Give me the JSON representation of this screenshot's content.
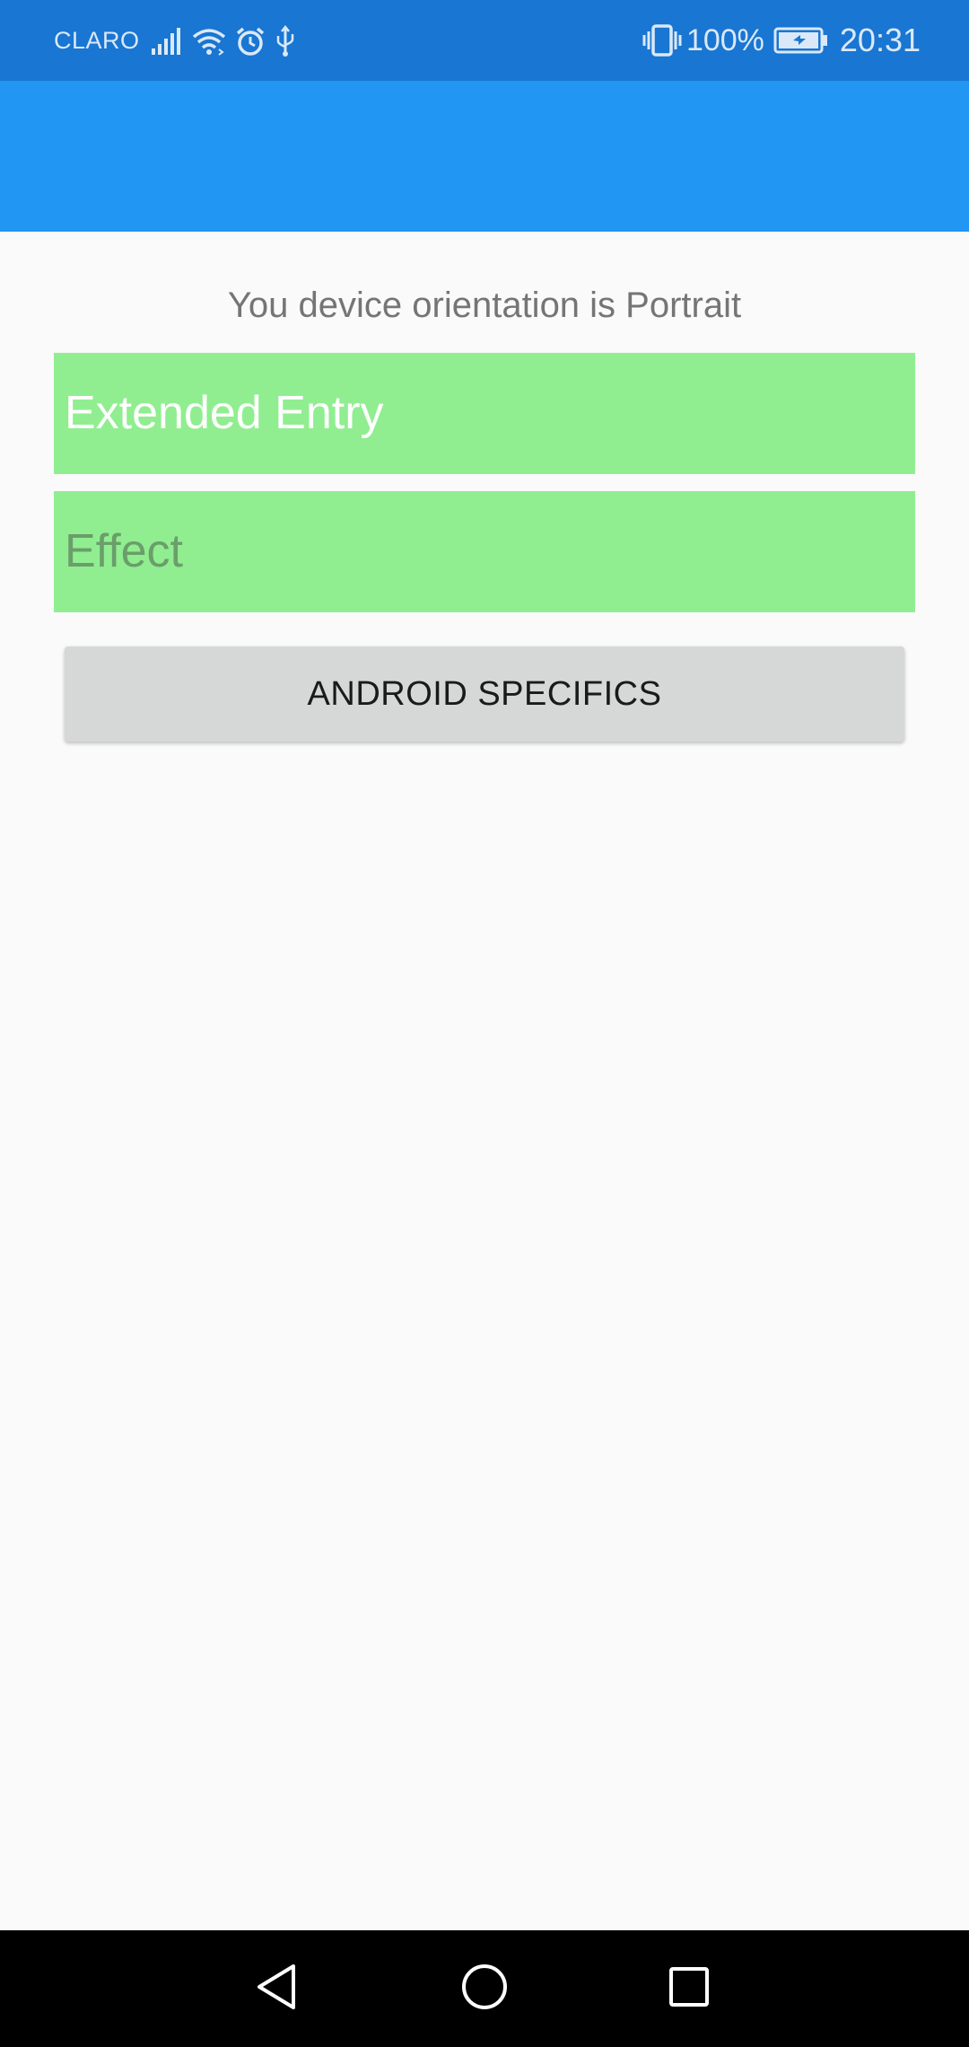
{
  "status_bar": {
    "carrier": "CLARO",
    "battery_percent": "100%",
    "time": "20:31",
    "icons": [
      "signal-icon",
      "wifi-icon",
      "alarm-icon",
      "usb-icon",
      "vibrate-icon",
      "battery-charging-icon"
    ]
  },
  "app_bar": {
    "title": ""
  },
  "main": {
    "orientation_label": "You device orientation is Portrait",
    "extended_entry_value": "Extended Entry",
    "effect_placeholder": "Effect",
    "android_specifics_button": "ANDROID SPECIFICS"
  },
  "nav_bar": {
    "icons": [
      "back-icon",
      "home-icon",
      "recents-icon"
    ]
  },
  "colors": {
    "status_bar": "#1976d2",
    "app_bar": "#2196f3",
    "entry_background": "#90ee90",
    "button_background": "#d6d7d7",
    "page_background": "#fafafa"
  }
}
